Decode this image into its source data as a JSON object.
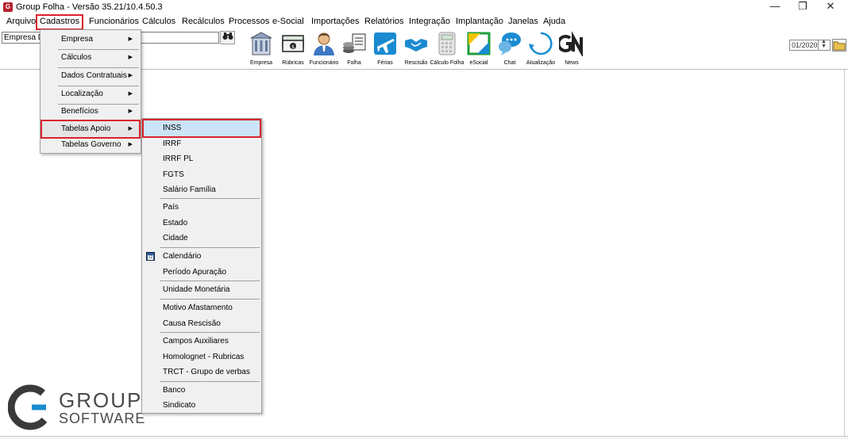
{
  "window": {
    "title": "Group Folha - Versão 35.21/10.4.50.3",
    "app_icon": "G",
    "minimize": "—",
    "restore": "❐",
    "close": "✕"
  },
  "menubar": [
    {
      "label": "Arquivo"
    },
    {
      "label": "Cadastros"
    },
    {
      "label": "Funcionários"
    },
    {
      "label": "Cálculos"
    },
    {
      "label": "Recálculos"
    },
    {
      "label": "Processos"
    },
    {
      "label": "e-Social"
    },
    {
      "label": "Importações"
    },
    {
      "label": "Relatórios"
    },
    {
      "label": "Integração"
    },
    {
      "label": "Implantação"
    },
    {
      "label": "Janelas"
    },
    {
      "label": "Ajuda"
    }
  ],
  "toolbar": {
    "company_value": "Empresa De",
    "binoculars_icon": "binoculars-icon",
    "buttons": [
      {
        "label": "Empresa",
        "icon": "building-icon"
      },
      {
        "label": "Rúbricas",
        "icon": "money-icon"
      },
      {
        "label": "Funcionário",
        "icon": "employee-icon"
      },
      {
        "label": "Folha",
        "icon": "payroll-icon"
      },
      {
        "label": "Férias",
        "icon": "vacation-icon"
      },
      {
        "label": "Rescisão",
        "icon": "handshake-icon"
      },
      {
        "label": "Cálculo Folha",
        "icon": "calculator-icon"
      },
      {
        "label": "eSocial",
        "icon": "esocial-icon"
      },
      {
        "label": "Chat",
        "icon": "chat-icon"
      },
      {
        "label": "Atualização",
        "icon": "refresh-icon"
      },
      {
        "label": "News",
        "icon": "news-icon"
      }
    ],
    "period": "01/2020"
  },
  "cadastros_menu": [
    {
      "label": "Empresa",
      "has_submenu": true
    },
    {
      "label": "Cálculos",
      "has_submenu": true
    },
    {
      "label": "Dados Contratuais",
      "has_submenu": true
    },
    {
      "label": "Localização",
      "has_submenu": true
    },
    {
      "label": "Benefícios",
      "has_submenu": true
    },
    {
      "label": "Tabelas Apoio",
      "has_submenu": true
    },
    {
      "label": "Tabelas Governo",
      "has_submenu": true
    }
  ],
  "tabelas_apoio_menu": [
    {
      "label": "INSS"
    },
    {
      "label": "IRRF"
    },
    {
      "label": "IRRF PL"
    },
    {
      "label": "FGTS"
    },
    {
      "label": "Salário Família"
    },
    {
      "label": "País"
    },
    {
      "label": "Estado"
    },
    {
      "label": "Cidade"
    },
    {
      "label": "Calendário",
      "icon": "calendar-icon"
    },
    {
      "label": "Período Apuração"
    },
    {
      "label": "Unidade Monetária"
    },
    {
      "label": "Motivo Afastamento"
    },
    {
      "label": "Causa Rescisão"
    },
    {
      "label": "Campos Auxiliares"
    },
    {
      "label": "Homolognet - Rubricas"
    },
    {
      "label": "TRCT - Grupo de verbas"
    },
    {
      "label": "Banco"
    },
    {
      "label": "Sindicato"
    }
  ],
  "logo": {
    "line1": "GROUP",
    "line2": "SOFTWARE"
  },
  "colors": {
    "highlight": "#d9232e",
    "brand_dark": "#333333",
    "brand_accent": "#1a8bd1"
  }
}
